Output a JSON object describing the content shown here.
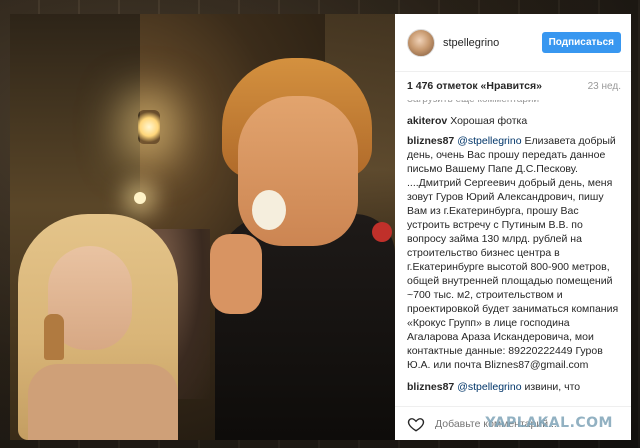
{
  "post": {
    "username": "stpellegrino",
    "follow_label": "Подписаться",
    "likes": "1 476 отметок «Нравится»",
    "age": "23 нед.",
    "load_more": "Загрузить еще комментарии"
  },
  "comments": [
    {
      "author": "akiterov",
      "text": "Хорошая фотка"
    },
    {
      "author": "bliznes87",
      "mention": "@stpellegrino",
      "text": "Елизавета добрый день, очень Вас прошу передать данное письмо Вашему Папе Д.С.Пескову. ....Дмитрий Сергеевич добрый день, меня зовут Гуров Юрий Александрович, пишу Вам из г.Екатеринбурга, прошу Вас устроить встречу с Путиным В.В. по вопросу займа 130 млрд. рублей на строительство бизнес центра в г.Екатеринбурге высотой 800-900 метров, общей внутренней площадью помещений ~700 тыс. м2, строительством и проектировкой будет заниматься компания «Крокус Групп» в лице господина Агаларова Араза Искандеровича, мои контактные данные: 89220222449 Гуров Ю.А. или почта Bliznes87@gmail.com"
    },
    {
      "author": "bliznes87",
      "mention": "@stpellegrino",
      "text": "извини, что"
    }
  ],
  "footer": {
    "add_comment_placeholder": "Добавьте комментарий...",
    "watermark": "YAPLAKAL.COM"
  },
  "colors": {
    "follow_button": "#3897f0",
    "mention": "#003569",
    "watermark": "#7fa4b8"
  }
}
